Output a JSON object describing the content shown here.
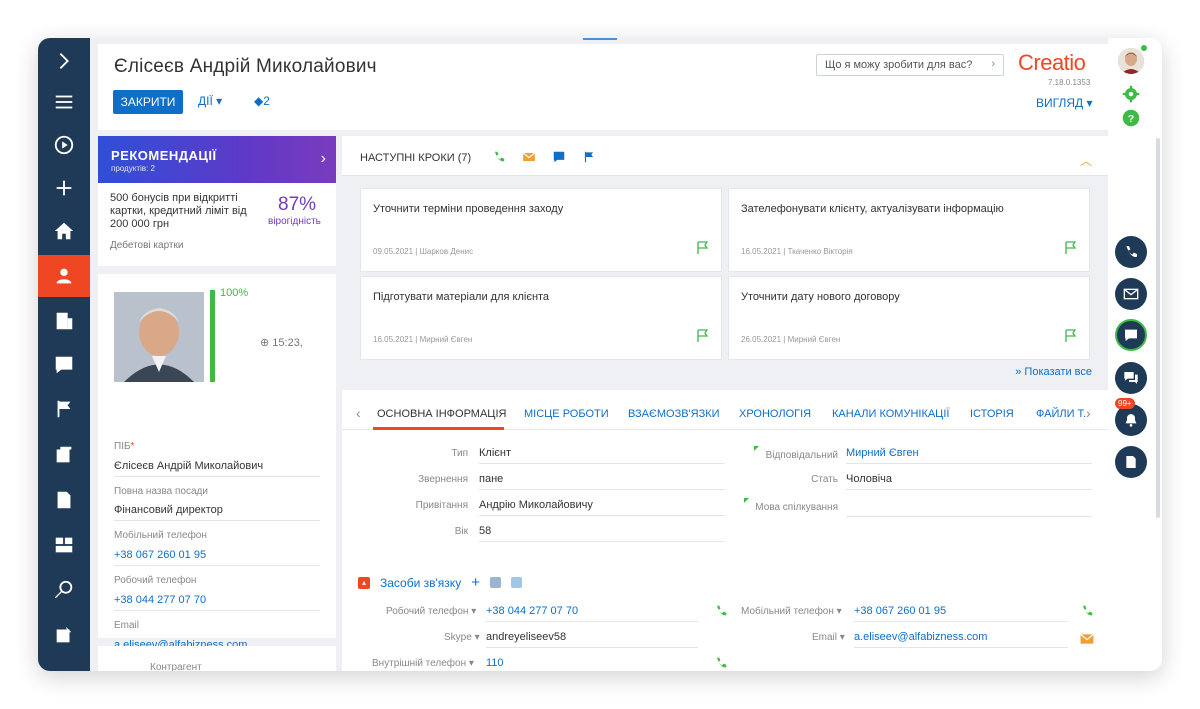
{
  "header": {
    "title": "Єлісеєв Андрій Миколайович",
    "close_label": "ЗАКРИТИ",
    "actions_label": "ДІЇ",
    "tags_count": "2",
    "search_placeholder": "Що я можу зробити для вас?",
    "logo": "Creatio",
    "version": "7.18.0.1353",
    "view_label": "ВИГЛЯД"
  },
  "recommendation": {
    "title": "РЕКОМЕНДАЦІЇ",
    "subtitle": "продуктів: 2",
    "text": "500 бонусів при відкритті картки, кредитний ліміт від 200 000 грн",
    "percent": "87%",
    "probability_label": "вірогідність",
    "category": "Дебетові картки"
  },
  "profile": {
    "completeness": "100%",
    "completeness_value": 1.0,
    "time": "15:23,",
    "fields": [
      {
        "label": "ПІБ",
        "value": "Єлісеєв Андрій Миколайович",
        "required": "*"
      },
      {
        "label": "Повна назва посади",
        "value": "Фінансовий директор"
      },
      {
        "label": "Мобільний телефон",
        "value": "+38 067 260 01 95"
      },
      {
        "label": "Робочий телефон",
        "value": "+38 044 277 07 70"
      },
      {
        "label": "Email",
        "value": "a.eliseev@alfabizness.com"
      }
    ],
    "next_section": "Контрагент"
  },
  "next_steps": {
    "title": "НАСТУПНІ КРОКИ (7)",
    "tasks": [
      {
        "title": "Уточнити терміни проведення заходу",
        "date": "09.05.2021",
        "owner": "Шарков Денис"
      },
      {
        "title": "Зателефонувати клієнту, актуалізувати інформацію",
        "date": "16.05.2021",
        "owner": "Ткаченко Вікторія"
      },
      {
        "title": "Підготувати матеріали для клієнта",
        "date": "16.05.2021",
        "owner": "Мирний Євген"
      },
      {
        "title": "Уточнити дату нового договору",
        "date": "26.05.2021",
        "owner": "Мирний Євген"
      }
    ],
    "show_all": "Показати все"
  },
  "tabs": [
    {
      "label": "ОСНОВНА ІНФОРМАЦІЯ"
    },
    {
      "label": "МІСЦЕ РОБОТИ"
    },
    {
      "label": "ВЗАЄМОЗВ'ЯЗКИ"
    },
    {
      "label": "ХРОНОЛОГІЯ"
    },
    {
      "label": "КАНАЛИ КОМУНІКАЦІЇ"
    },
    {
      "label": "ІСТОРІЯ"
    },
    {
      "label": "ФАЙЛИ Т."
    }
  ],
  "main_info": {
    "type_label": "Тип",
    "type_value": "Клієнт",
    "address_label": "Звернення",
    "address_value": "пане",
    "greeting_label": "Привітання",
    "greeting_value": "Андрію Миколайовичу",
    "age_label": "Вік",
    "age_value": "58",
    "owner_label": "Відповідальний",
    "owner_value": "Мирний Євген",
    "gender_label": "Стать",
    "gender_value": "Чоловіча",
    "language_label": "Мова спілкування",
    "language_value": ""
  },
  "contacts": {
    "title": "Засоби зв'язку",
    "work_phone_label": "Робочий телефон",
    "work_phone_value": "+38 044 277 07 70",
    "skype_label": "Skype",
    "skype_value": "andreyeliseev58",
    "internal_phone_label": "Внутрішній телефон",
    "internal_phone_value": "110",
    "mobile_label": "Мобільний телефон",
    "mobile_value": "+38 067 260 01 95",
    "email_label": "Email",
    "email_value": "a.eliseev@alfabizness.com"
  },
  "notifications_badge": "99+",
  "colors": {
    "accent": "#ef4723",
    "nav": "#1f3a56",
    "link": "#0e6ec8",
    "success": "#3dbb45"
  }
}
